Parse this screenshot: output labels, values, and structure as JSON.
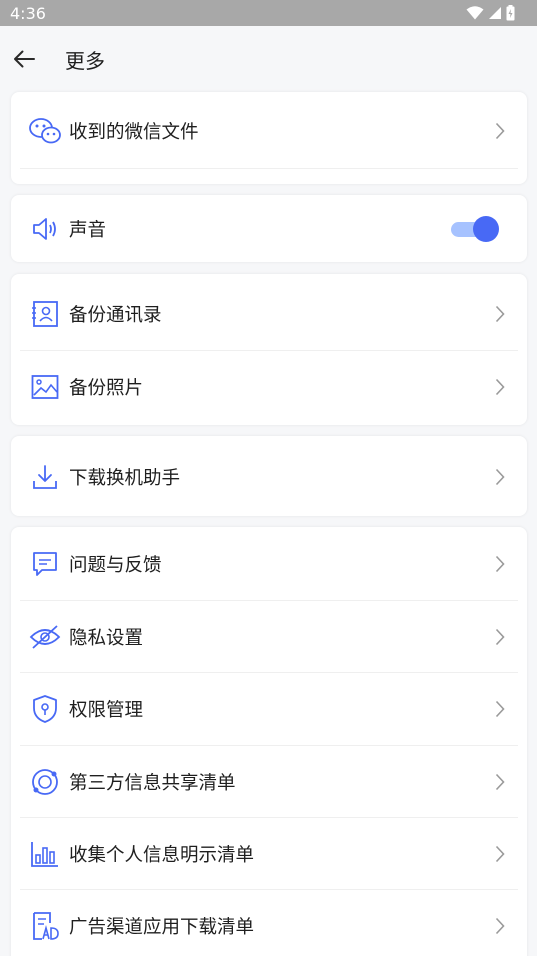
{
  "status_bar": {
    "time": "4:36"
  },
  "app_bar": {
    "title": "更多"
  },
  "groups": {
    "wechat": {
      "label": "收到的微信文件"
    },
    "sound": {
      "label": "声音",
      "toggle_on": true
    },
    "backup_contacts": {
      "label": "备份通讯录"
    },
    "backup_photos": {
      "label": "备份照片"
    },
    "download_helper": {
      "label": "下载换机助手"
    },
    "feedback": {
      "label": "问题与反馈"
    },
    "privacy": {
      "label": "隐私设置"
    },
    "permissions": {
      "label": "权限管理"
    },
    "third_party": {
      "label": "第三方信息共享清单"
    },
    "personal_info": {
      "label": "收集个人信息明示清单"
    },
    "ad_channel": {
      "label": "广告渠道应用下载清单"
    }
  },
  "colors": {
    "accent": "#4869f5",
    "toggle_track": "#a6c2ff",
    "status_bar": "#a8a8a8"
  }
}
